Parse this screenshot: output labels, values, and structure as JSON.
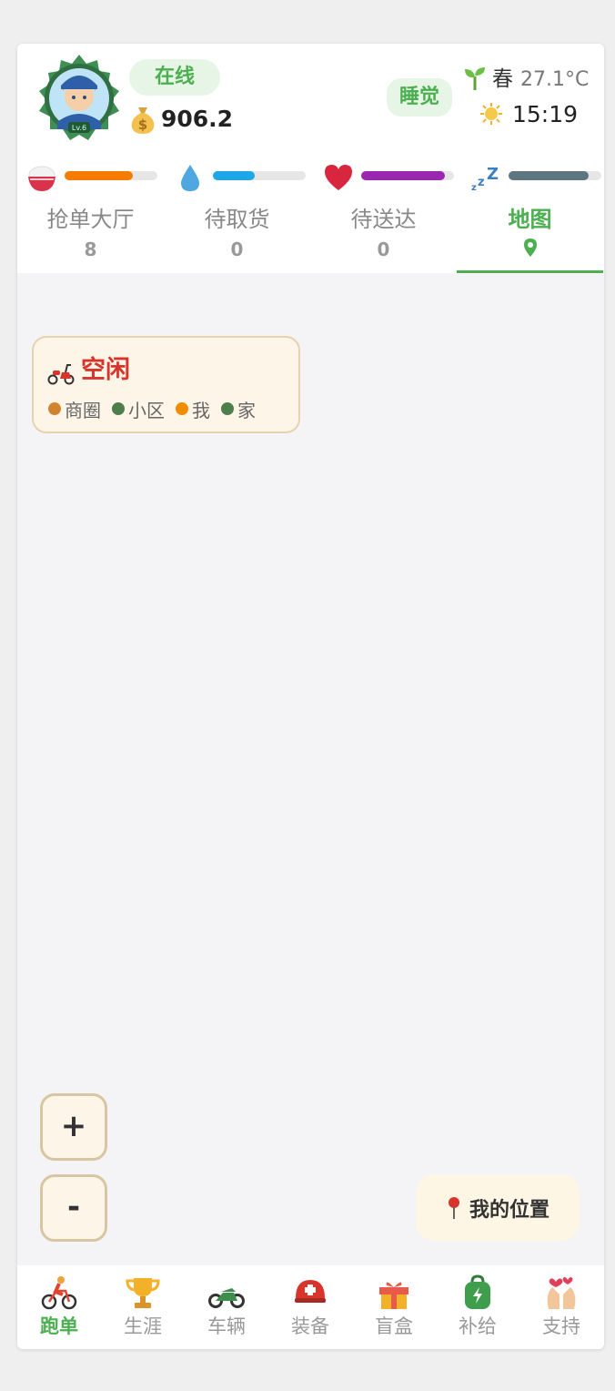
{
  "header": {
    "status": "在线",
    "money": "906.2",
    "sleep_label": "睡觉",
    "season": "春",
    "temperature": "27.1°C",
    "time": "15:19"
  },
  "stats": [
    {
      "name": "food",
      "icon": "rice-bowl-icon",
      "level": 0.74,
      "color": "#f57c00"
    },
    {
      "name": "water",
      "icon": "water-drop-icon",
      "level": 0.45,
      "color": "#1ea7e8"
    },
    {
      "name": "health",
      "icon": "heart-icon",
      "level": 0.9,
      "color": "#9b27b0"
    },
    {
      "name": "sleep",
      "icon": "zzz-icon",
      "level": 0.86,
      "color": "#5d7680"
    }
  ],
  "tabs": [
    {
      "label": "抢单大厅",
      "count": "8",
      "active": false
    },
    {
      "label": "待取货",
      "count": "0",
      "active": false
    },
    {
      "label": "待送达",
      "count": "0",
      "active": false
    },
    {
      "label": "地图",
      "count": "",
      "active": true
    }
  ],
  "idle_card": {
    "title": "空闲",
    "legend": [
      {
        "label": "商圈",
        "color": "#d0842e"
      },
      {
        "label": "小区",
        "color": "#4e7e4a"
      },
      {
        "label": "我",
        "color": "#f08c00"
      },
      {
        "label": "家",
        "color": "#4e7e4a"
      }
    ]
  },
  "zoom": {
    "in_label": "+",
    "out_label": "-"
  },
  "locate": {
    "label": "我的位置"
  },
  "bottom_nav": [
    {
      "label": "跑单",
      "icon": "cyclist-icon",
      "active": true
    },
    {
      "label": "生涯",
      "icon": "trophy-icon",
      "active": false
    },
    {
      "label": "车辆",
      "icon": "motorcycle-icon",
      "active": false
    },
    {
      "label": "装备",
      "icon": "helmet-icon",
      "active": false
    },
    {
      "label": "盲盒",
      "icon": "gift-box-icon",
      "active": false
    },
    {
      "label": "补给",
      "icon": "backpack-icon",
      "active": false
    },
    {
      "label": "支持",
      "icon": "heart-hands-icon",
      "active": false
    }
  ],
  "colors": {
    "accent": "#4caf50",
    "idle_red": "#d9342b",
    "cream": "#fdf6e8"
  }
}
